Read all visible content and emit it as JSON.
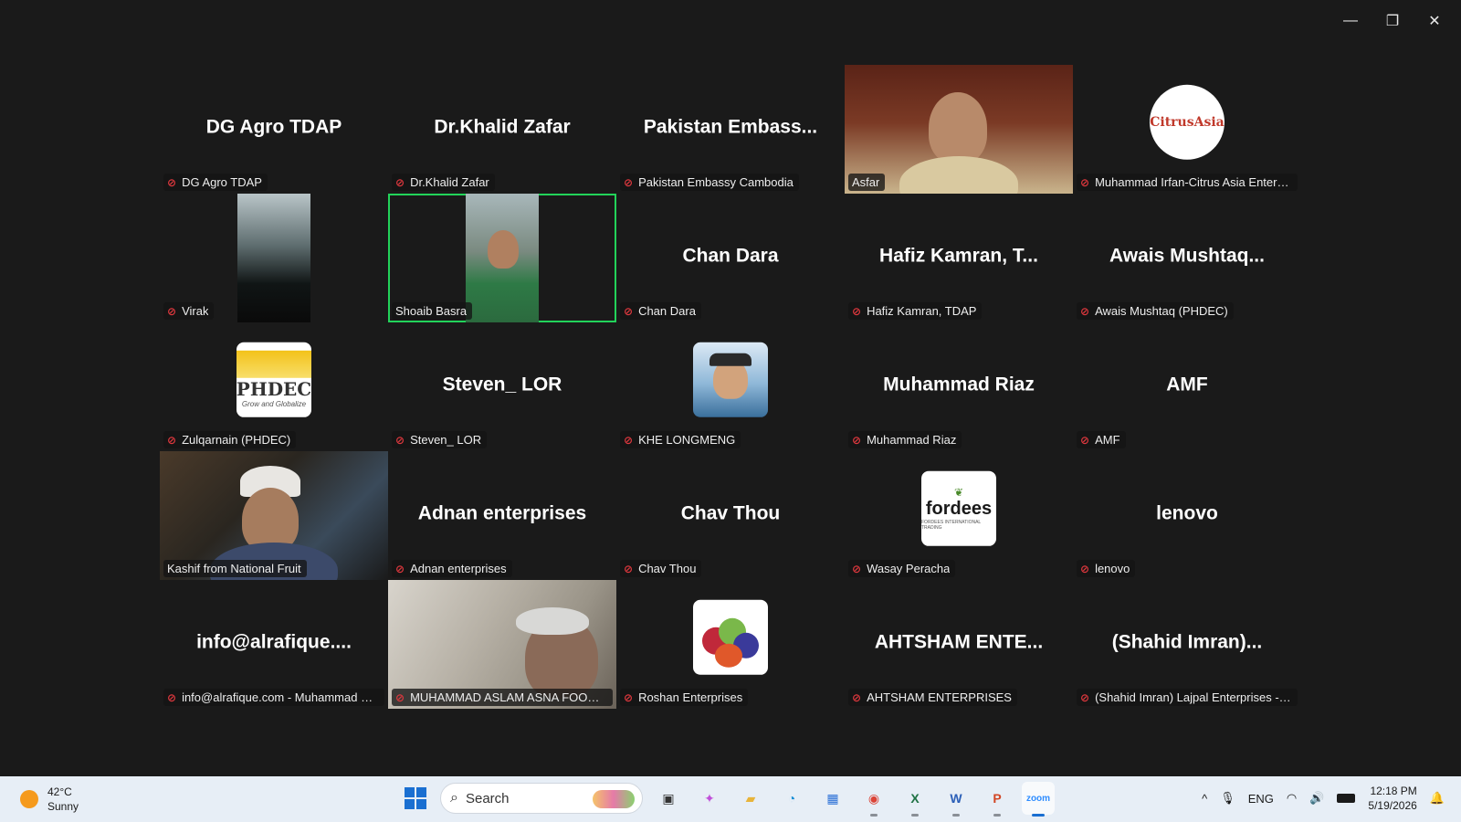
{
  "window": {
    "minimize": "—",
    "restore": "❐",
    "close": "✕"
  },
  "tiles": [
    {
      "display": "DG Agro TDAP",
      "label": "DG Agro TDAP"
    },
    {
      "display": "Dr.Khalid Zafar",
      "label": "Dr.Khalid Zafar"
    },
    {
      "display": "Pakistan  Embass...",
      "label": "Pakistan Embassy Cambodia"
    },
    {
      "label": "Asfar"
    },
    {
      "label": "Muhammad Irfan-Citrus Asia Enterpr...",
      "avatar_text": "CitrusAsia"
    },
    {
      "label": "Virak"
    },
    {
      "label": "Shoaib Basra"
    },
    {
      "display": "Chan Dara",
      "label": "Chan Dara"
    },
    {
      "display": "Hafiz Kamran,  T...",
      "label": "Hafiz Kamran, TDAP"
    },
    {
      "display": "Awais  Mushtaq...",
      "label": "Awais Mushtaq (PHDEC)"
    },
    {
      "label": "Zulqarnain (PHDEC)",
      "avatar_text": "PHDEC",
      "avatar_sub": "Grow and Globalize"
    },
    {
      "display": "Steven_ LOR",
      "label": "Steven_ LOR"
    },
    {
      "label": "KHE LONGMENG"
    },
    {
      "display": "Muhammad Riaz",
      "label": "Muhammad Riaz"
    },
    {
      "display": "AMF",
      "label": "AMF"
    },
    {
      "label": "Kashif from National Fruit"
    },
    {
      "display": "Adnan enterprises",
      "label": "Adnan enterprises"
    },
    {
      "display": "Chav Thou",
      "label": "Chav Thou"
    },
    {
      "label": "Wasay Peracha",
      "avatar_text": "fordees",
      "avatar_sub": "FORDEES INTERNATIONAL TRADING"
    },
    {
      "display": "lenovo",
      "label": "lenovo"
    },
    {
      "display": "info@alrafique....",
      "label": "info@alrafique.com - Muhammad Riaz"
    },
    {
      "label": "MUHAMMAD ASLAM ASNA FOODS ..."
    },
    {
      "label": "Roshan Enterprises"
    },
    {
      "display": "AHTSHAM  ENTE...",
      "label": "AHTSHAM ENTERPRISES"
    },
    {
      "display": "(Shahid  Imran)...",
      "label": "(Shahid Imran) Lajpal Enterprises - B..."
    }
  ],
  "taskbar": {
    "weather": {
      "temp": "42°C",
      "condition": "Sunny"
    },
    "search_placeholder": "Search",
    "apps": [
      {
        "name": "task-view",
        "glyph": "▣",
        "color": "#333333"
      },
      {
        "name": "copilot",
        "glyph": "✦",
        "color": "#c04fd9"
      },
      {
        "name": "file-explorer",
        "glyph": "▰",
        "color": "#e8b43a"
      },
      {
        "name": "edge",
        "glyph": "◔",
        "color": "#1a8fd6"
      },
      {
        "name": "store",
        "glyph": "▦",
        "color": "#2a6fd6"
      },
      {
        "name": "chrome",
        "glyph": "◉",
        "color": "#db4437"
      },
      {
        "name": "excel",
        "glyph": "X",
        "color": "#1f7244"
      },
      {
        "name": "word",
        "glyph": "W",
        "color": "#2b5fb8"
      },
      {
        "name": "powerpoint",
        "glyph": "P",
        "color": "#d24726"
      },
      {
        "name": "zoom",
        "glyph": "zoom",
        "color": "#2d8cff"
      }
    ],
    "tray": {
      "chevron": "^",
      "lang": "ENG",
      "time": "12:18 PM",
      "date": "5/19/2026"
    }
  }
}
